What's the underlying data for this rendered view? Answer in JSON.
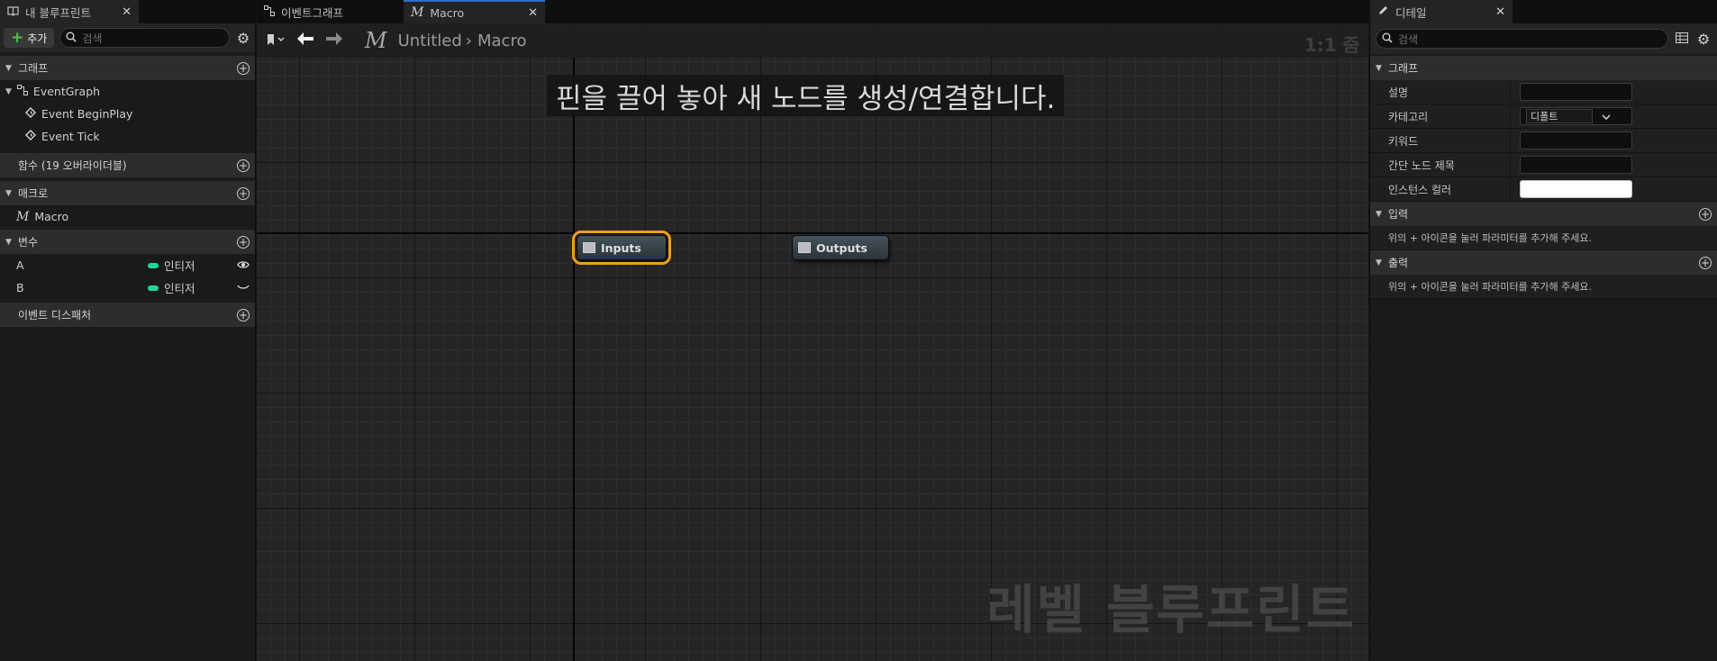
{
  "left_panel": {
    "tab_label": "내 블루프린트",
    "add_label": "추가",
    "search_placeholder": "검색",
    "sections": {
      "graph": "그래프",
      "functions": "함수 (19 오버라이더블)",
      "macros": "매크로",
      "variables": "변수",
      "dispatchers": "이벤트 디스패처"
    },
    "graph_items": {
      "event_graph": "EventGraph",
      "begin_play": "Event BeginPlay",
      "tick": "Event Tick"
    },
    "macro_items": [
      "Macro"
    ],
    "variables": [
      {
        "name": "A",
        "type": "인티저",
        "visibility_icon": "eye-open-icon"
      },
      {
        "name": "B",
        "type": "인티저",
        "visibility_icon": "eye-closed-icon"
      }
    ],
    "variable_type_color": "#1fd6a0"
  },
  "editor_tabs": {
    "event_graph": "이벤트그래프",
    "macro": "Macro"
  },
  "graph_toolbar": {
    "macro_icon_glyph": "M",
    "breadcrumb_root": "Untitled",
    "breadcrumb_leaf": "Macro",
    "zoom": "1:1 줌"
  },
  "graph": {
    "hint": "핀을 끌어 놓아 새 노드를 생성/연결합니다.",
    "watermark": "레벨 블루프린트",
    "nodes": {
      "inputs": "Inputs",
      "outputs": "Outputs"
    },
    "selection_color": "#f39d15"
  },
  "details": {
    "tab_label": "디테일",
    "search_placeholder": "검색",
    "graph_section": "그래프",
    "props": {
      "description": "설명",
      "category": "카테고리",
      "category_value": "디폴트",
      "keywords": "키워드",
      "compact_title": "간단 노드 제목",
      "instance_color": "인스턴스 컬러"
    },
    "inputs_section": "입력",
    "inputs_msg": "위의 + 아이콘을 눌러 파라미터를 추가해 주세요.",
    "outputs_section": "출력",
    "outputs_msg": "위의 + 아이콘을 눌러 파라미터를 추가해 주세요."
  }
}
